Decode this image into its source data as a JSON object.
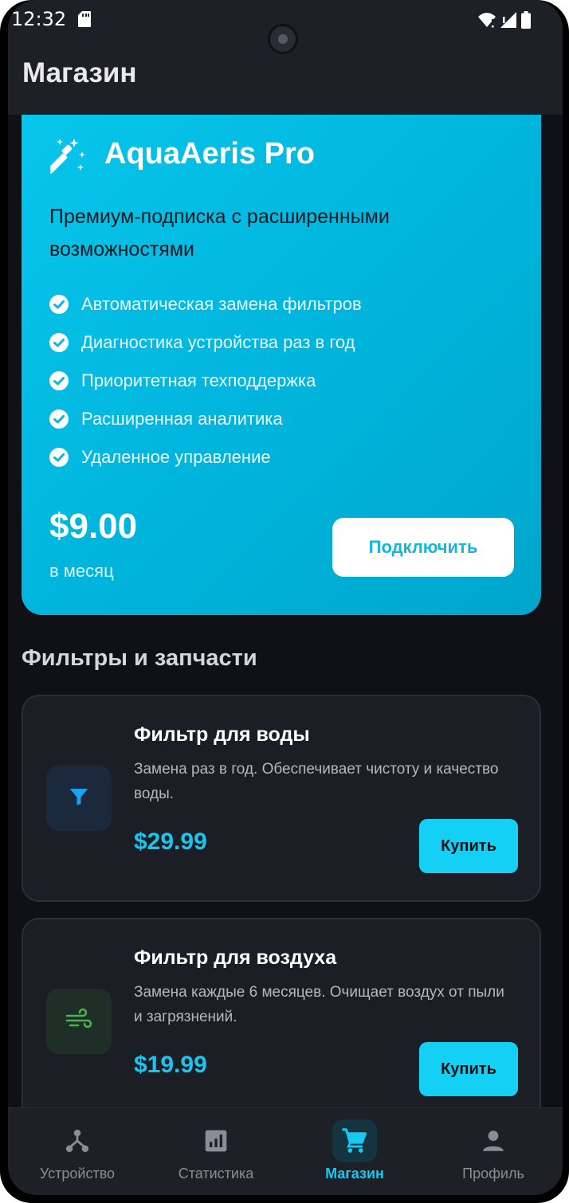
{
  "status_bar": {
    "time": "12:32"
  },
  "app_bar": {
    "title": "Магазин"
  },
  "pro_card": {
    "title": "AquaAeris Pro",
    "subtitle": "Премиум-подписка с расширенными возможностями",
    "features": [
      "Автоматическая замена фильтров",
      "Диагностика устройства раз в год",
      "Приоритетная техподдержка",
      "Расширенная аналитика",
      "Удаленное управление"
    ],
    "price": "$9.00",
    "period": "в месяц",
    "subscribe_label": "Подключить",
    "icon": "magic-wand-icon",
    "gradient_colors": [
      "#08c6ec",
      "#00a6cc"
    ]
  },
  "section": {
    "title": "Фильтры и запчасти"
  },
  "products": [
    {
      "name": "Фильтр для воды",
      "description": "Замена раз в год. Обеспечивает чистоту и качество воды.",
      "price": "$29.99",
      "buy_label": "Купить",
      "icon": "funnel-icon",
      "icon_color": "#1ba3f0"
    },
    {
      "name": "Фильтр для воздуха",
      "description": "Замена каждые 6 месяцев. Очищает воздух от пыли и загрязнений.",
      "price": "$19.99",
      "buy_label": "Купить",
      "icon": "wind-icon",
      "icon_color": "#4caf50"
    }
  ],
  "bottom_nav": {
    "items": [
      {
        "label": "Устройство",
        "icon": "device-hub-icon",
        "active": false
      },
      {
        "label": "Статистика",
        "icon": "stats-icon",
        "active": false
      },
      {
        "label": "Магазин",
        "icon": "cart-icon",
        "active": true
      },
      {
        "label": "Профиль",
        "icon": "person-icon",
        "active": false
      }
    ]
  },
  "colors": {
    "accent": "#17c8f0",
    "background": "#0f1117",
    "card": "#1b1e25",
    "bar": "#1e2028"
  }
}
